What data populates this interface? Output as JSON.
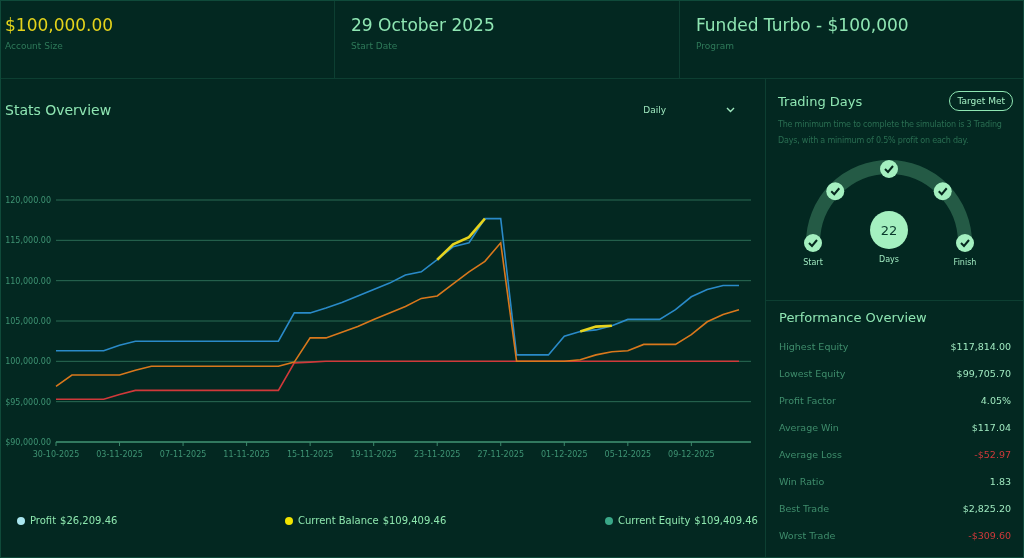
{
  "summary": [
    {
      "value": "$100,000.00",
      "label": "Account Size",
      "kind": "highlight"
    },
    {
      "value": "29 October 2025",
      "label": "Start Date",
      "kind": "normal"
    },
    {
      "value": "Funded Turbo - $100,000",
      "label": "Program",
      "kind": "normal"
    }
  ],
  "stats": {
    "title": "Stats Overview",
    "period": "Daily",
    "chart_data": {
      "type": "line",
      "categories": [
        "30-10-2025",
        null,
        null,
        null,
        "03-11-2025",
        null,
        null,
        null,
        "07-11-2025",
        null,
        null,
        null,
        "11-11-2025",
        null,
        null,
        null,
        "15-11-2025",
        null,
        null,
        null,
        "19-11-2025",
        null,
        null,
        null,
        "23-11-2025",
        null,
        null,
        null,
        "27-11-2025",
        null,
        null,
        null,
        "01-12-2025",
        null,
        null,
        null,
        "05-12-2025",
        null,
        null,
        null,
        "09-12-2025",
        null,
        null,
        null
      ],
      "grid": true,
      "series": [
        {
          "color": "#e6d31c",
          "values": [
            null,
            null,
            null,
            null,
            null,
            null,
            null,
            null,
            null,
            null,
            null,
            null,
            null,
            null,
            null,
            null,
            null,
            null,
            null,
            null,
            null,
            null,
            null,
            null,
            112600,
            114500,
            115400,
            117700,
            null,
            null,
            null,
            null,
            null,
            103700,
            104300,
            104400,
            null,
            null,
            null,
            null,
            null,
            null,
            null,
            null
          ]
        },
        {
          "color": "#2a8ac8",
          "values": [
            101300,
            101300,
            101300,
            101300,
            102000,
            102500,
            102500,
            102500,
            102500,
            102500,
            102500,
            102500,
            102500,
            102500,
            102500,
            106000,
            106000,
            106600,
            107300,
            108100,
            108900,
            109700,
            110700,
            111100,
            112600,
            114200,
            114700,
            117700,
            117700,
            100800,
            100800,
            100800,
            103100,
            103700,
            103900,
            104400,
            105200,
            105200,
            105200,
            106400,
            108000,
            108900,
            109400,
            109400
          ]
        },
        {
          "color": "#d9781c",
          "values": [
            96900,
            98300,
            98300,
            98300,
            98300,
            98900,
            99400,
            99400,
            99400,
            99400,
            99400,
            99400,
            99400,
            99400,
            99400,
            99900,
            102900,
            102900,
            103600,
            104300,
            105200,
            106000,
            106800,
            107800,
            108100,
            109600,
            111100,
            112400,
            114700,
            100000,
            100000,
            100000,
            100000,
            100200,
            100800,
            101200,
            101300,
            102100,
            102100,
            102100,
            103300,
            104900,
            105800,
            106400
          ]
        },
        {
          "color": "#d0393a",
          "values": [
            95300,
            95300,
            95300,
            95300,
            95900,
            96400,
            96400,
            96400,
            96400,
            96400,
            96400,
            96400,
            96400,
            96400,
            96400,
            99800,
            99900,
            100000,
            100000,
            100000,
            100000,
            100000,
            100000,
            100000,
            100000,
            100000,
            100000,
            100000,
            100000,
            100000,
            100000,
            100000,
            100000,
            100000,
            100000,
            100000,
            100000,
            100000,
            100000,
            100000,
            100000,
            100000,
            100000,
            100000
          ]
        }
      ],
      "ylim": [
        90000,
        120000
      ],
      "yticks": [
        {
          "value": 90000,
          "label": "$90,000.00"
        },
        {
          "value": 95000,
          "label": "$95,000.00"
        },
        {
          "value": 100000,
          "label": "100,000.00"
        },
        {
          "value": 105000,
          "label": "105,000.00"
        },
        {
          "value": 110000,
          "label": "110,000.00"
        },
        {
          "value": 115000,
          "label": "115,000.00"
        },
        {
          "value": 120000,
          "label": "120,000.00"
        }
      ]
    },
    "legend": [
      {
        "label": "Profit",
        "value": "$26,209.46",
        "color": "#a9e6ef"
      },
      {
        "label": "Current Balance",
        "value": "$109,409.46",
        "color": "#f2e400"
      },
      {
        "label": "Current Equity",
        "value": "$109,409.46",
        "color": "#3aa888"
      }
    ]
  },
  "trading_days": {
    "title": "Trading Days",
    "badge": "Target Met",
    "description": "The minimum time to complete the simulation is 3 Trading Days, with a minimum of 0.5% profit on each day.",
    "milestones": [
      {
        "label": "Start",
        "checked": true
      },
      {
        "checked": true
      },
      {
        "checked": true
      },
      {
        "checked": true
      },
      {
        "label": "Finish",
        "checked": true
      }
    ],
    "count": "22",
    "count_label": "Days"
  },
  "performance": {
    "title": "Performance Overview",
    "rows": [
      {
        "label": "Highest Equity",
        "value": "$117,814.00",
        "kind": "positive"
      },
      {
        "label": "Lowest Equity",
        "value": "$99,705.70",
        "kind": "positive"
      },
      {
        "label": "Profit Factor",
        "value": "4.05%",
        "kind": "positive"
      },
      {
        "label": "Average Win",
        "value": "$117.04",
        "kind": "positive"
      },
      {
        "label": "Average Loss",
        "value": "-$52.97",
        "kind": "negative"
      },
      {
        "label": "Win Ratio",
        "value": "1.83",
        "kind": "positive"
      },
      {
        "label": "Best Trade",
        "value": "$2,825.20",
        "kind": "positive"
      },
      {
        "label": "Worst Trade",
        "value": "-$309.60",
        "kind": "negative"
      }
    ]
  }
}
